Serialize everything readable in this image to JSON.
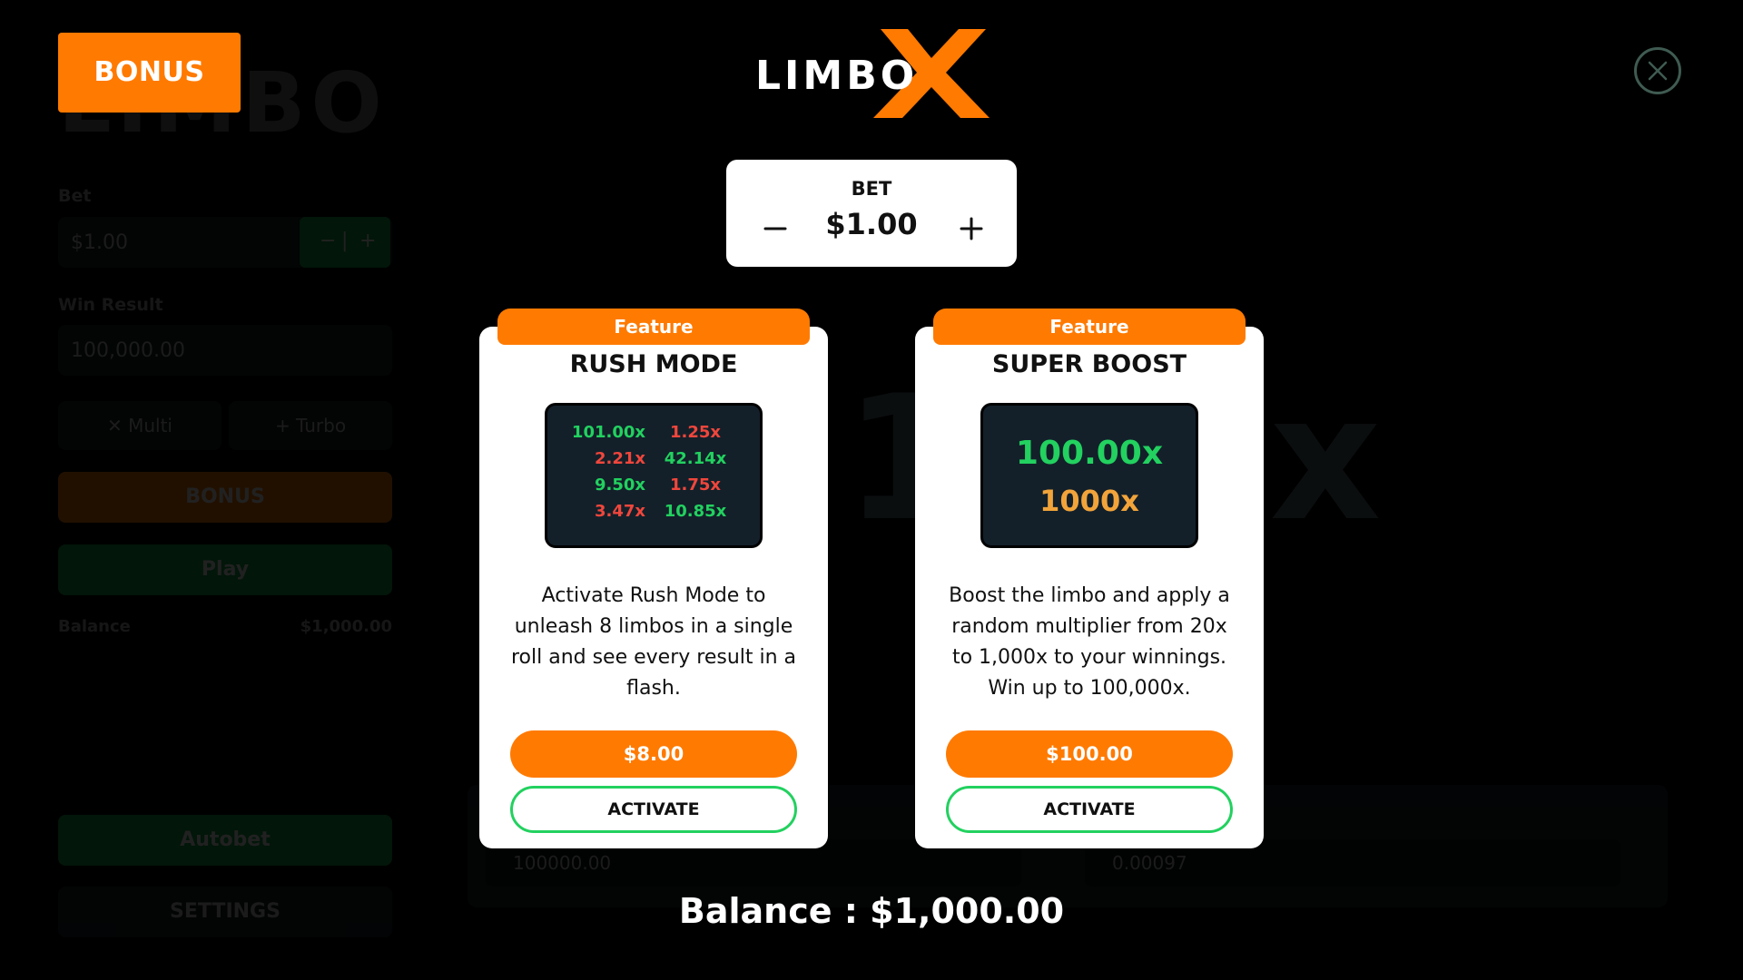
{
  "colors": {
    "accent": "#ff7a00",
    "green": "#22d15f",
    "red": "#f0463c",
    "gold": "#f2a43a",
    "screen_bg": "#13202a",
    "close_ring": "#3f5b52"
  },
  "bonus_tag": "BONUS",
  "logo": {
    "text": "LIMBO"
  },
  "close_icon": "close-icon",
  "bet": {
    "label": "BET",
    "value": "$1.00",
    "minus_icon": "minus-icon",
    "plus_icon": "plus-icon"
  },
  "cards": [
    {
      "tab": "Feature",
      "title": "RUSH MODE",
      "multipliers": [
        {
          "text": "101.00x",
          "color": "green"
        },
        {
          "text": "1.25x",
          "color": "red"
        },
        {
          "text": "2.21x",
          "color": "red"
        },
        {
          "text": "42.14x",
          "color": "green"
        },
        {
          "text": "9.50x",
          "color": "green"
        },
        {
          "text": "1.75x",
          "color": "red"
        },
        {
          "text": "3.47x",
          "color": "red"
        },
        {
          "text": "10.85x",
          "color": "green"
        }
      ],
      "description": "Activate Rush Mode to unleash 8 limbos in a single roll and see every result in a flash.",
      "price": "$8.00",
      "activate": "ACTIVATE"
    },
    {
      "tab": "Feature",
      "title": "SUPER BOOST",
      "boost_main": "100.00x",
      "boost_sub": "1000x",
      "description": "Boost the limbo and apply a random multiplier from 20x to 1,000x to your winnings. Win up to 100,000x.",
      "price": "$100.00",
      "activate": "ACTIVATE"
    }
  ],
  "balance": "Balance : $1,000.00",
  "background": {
    "logo": "LIMBO",
    "bet_label": "Bet",
    "bet_value": "$1.00",
    "win_label": "Win Result",
    "win_value": "100,000.00",
    "multi": "✕ Multi",
    "turbo": "+ Turbo",
    "bonus": "BONUS",
    "play": "Play",
    "balance_label": "Balance",
    "balance_value": "$1,000.00",
    "autobet": "Autobet",
    "settings": "SETTINGS",
    "big_multiplier": "1.00x",
    "input_left": "100000.00",
    "input_right": "0.00097"
  }
}
